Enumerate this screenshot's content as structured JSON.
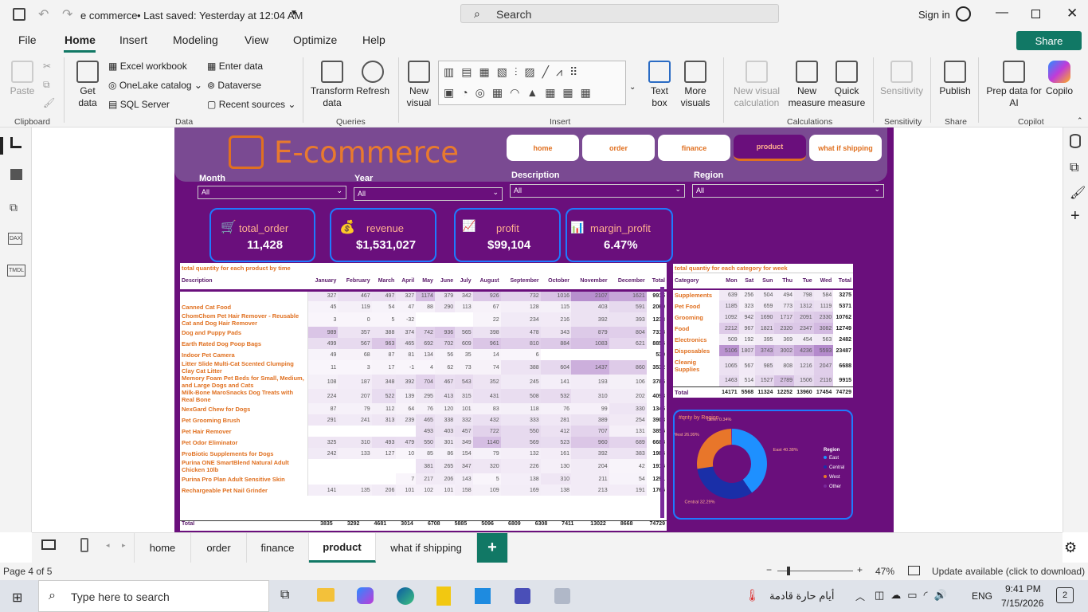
{
  "titlebar": {
    "title": "e commerce",
    "saved": "• Last saved: Yesterday at 12:04 AM",
    "search": "Search",
    "signin": "Sign in"
  },
  "menu": [
    "File",
    "Home",
    "Insert",
    "Modeling",
    "View",
    "Optimize",
    "Help"
  ],
  "share": "Share",
  "ribbon": {
    "paste": "Paste",
    "clipboard": "Clipboard",
    "get_data": "Get data",
    "excel": "Excel workbook",
    "onelake": "OneLake catalog",
    "sql": "SQL Server",
    "enter_data": "Enter data",
    "dataverse": "Dataverse",
    "recent": "Recent sources",
    "data": "Data",
    "transform": "Transform data",
    "refresh": "Refresh",
    "queries": "Queries",
    "new_visual": "New visual",
    "text_box": "Text box",
    "more_visuals": "More visuals",
    "insert": "Insert",
    "new_visual_calc": "New visual calculation",
    "new_measure": "New measure",
    "quick_measure": "Quick measure",
    "calculations": "Calculations",
    "sensitivity": "Sensitivity",
    "sensitivity_grp": "Sensitivity",
    "publish": "Publish",
    "share_grp": "Share",
    "prep": "Prep data for AI",
    "copilot": "Copilo",
    "copilot_grp": "Copilot"
  },
  "report": {
    "title": "E-commerce",
    "nav": [
      "home",
      "order",
      "finance",
      "product",
      "what if shipping"
    ],
    "filters": [
      {
        "label": "Month",
        "value": "All"
      },
      {
        "label": "Year",
        "value": "All"
      },
      {
        "label": "Description",
        "value": "All"
      },
      {
        "label": "Region",
        "value": "All"
      }
    ],
    "cards": [
      {
        "label": "total_order",
        "value": "11,428"
      },
      {
        "label": "revenue",
        "value": "$1,531,027"
      },
      {
        "label": "profit",
        "value": "$99,104"
      },
      {
        "label": "margin_profit",
        "value": "6.47%"
      }
    ],
    "table1": {
      "title": "total quantity for each product by time",
      "headers": [
        "Description",
        "January",
        "February",
        "March",
        "April",
        "May",
        "June",
        "July",
        "August",
        "September",
        "October",
        "November",
        "December",
        "Total"
      ],
      "rows": [
        [
          "",
          "327",
          "467",
          "497",
          "327",
          "1174",
          "379",
          "342",
          "926",
          "732",
          "1016",
          "2107",
          "1621",
          "9915"
        ],
        [
          "Canned Cat Food",
          "45",
          "119",
          "54",
          "47",
          "88",
          "290",
          "113",
          "67",
          "128",
          "115",
          "403",
          "591",
          "2060"
        ],
        [
          "ChomChom Pet Hair Remover - Reusable Cat and Dog Hair Remover",
          "3",
          "0",
          "5",
          "-32",
          "",
          "",
          "",
          "22",
          "234",
          "216",
          "392",
          "393",
          "1233"
        ],
        [
          "Dog and Puppy Pads",
          "989",
          "357",
          "388",
          "374",
          "742",
          "936",
          "565",
          "398",
          "478",
          "343",
          "879",
          "804",
          "7313"
        ],
        [
          "Earth Rated Dog Poop Bags",
          "499",
          "567",
          "963",
          "465",
          "692",
          "702",
          "609",
          "961",
          "810",
          "884",
          "1083",
          "621",
          "8856"
        ],
        [
          "Indoor Pet Camera",
          "49",
          "68",
          "87",
          "81",
          "134",
          "56",
          "35",
          "14",
          "6",
          "",
          "",
          "",
          "530"
        ],
        [
          "Litter Slide Multi-Cat Scented Clumping Clay Cat Litter",
          "11",
          "3",
          "17",
          "-1",
          "4",
          "62",
          "73",
          "74",
          "388",
          "604",
          "1437",
          "860",
          "3532"
        ],
        [
          "Memory Foam Pet Beds for Small, Medium, and Large Dogs and Cats",
          "108",
          "187",
          "348",
          "392",
          "704",
          "467",
          "543",
          "352",
          "245",
          "141",
          "193",
          "106",
          "3786"
        ],
        [
          "Milk-Bone MaroSnacks Dog Treats with Real Bone",
          "224",
          "207",
          "522",
          "139",
          "295",
          "413",
          "315",
          "431",
          "508",
          "532",
          "310",
          "202",
          "4098"
        ],
        [
          "NexGard Chew for Dogs",
          "87",
          "79",
          "112",
          "64",
          "76",
          "120",
          "101",
          "83",
          "118",
          "76",
          "99",
          "330",
          "1345"
        ],
        [
          "Pet Grooming Brush",
          "291",
          "241",
          "313",
          "239",
          "465",
          "338",
          "332",
          "432",
          "333",
          "281",
          "389",
          "254",
          "3908"
        ],
        [
          "Pet Hair Remover",
          "",
          "",
          "",
          "",
          "493",
          "403",
          "457",
          "722",
          "550",
          "412",
          "707",
          "131",
          "3855"
        ],
        [
          "Pet Odor Eliminator",
          "325",
          "310",
          "493",
          "479",
          "550",
          "301",
          "349",
          "1140",
          "569",
          "523",
          "960",
          "689",
          "6688"
        ],
        [
          "ProBiotic Supplements for Dogs",
          "242",
          "133",
          "127",
          "10",
          "85",
          "86",
          "154",
          "79",
          "132",
          "161",
          "392",
          "383",
          "1984"
        ],
        [
          "Purina ONE SmartBlend Natural Adult Chicken 10lb",
          "",
          "",
          "",
          "",
          "381",
          "265",
          "347",
          "320",
          "226",
          "130",
          "204",
          "42",
          "1915"
        ],
        [
          "Purina Pro Plan Adult Sensitive Skin",
          "",
          "",
          "",
          "7",
          "217",
          "206",
          "143",
          "5",
          "138",
          "310",
          "211",
          "54",
          "1291"
        ],
        [
          "Rechargeable Pet Nail Grinder",
          "141",
          "135",
          "206",
          "101",
          "102",
          "101",
          "158",
          "109",
          "169",
          "138",
          "213",
          "191",
          "1766"
        ]
      ],
      "total": [
        "Total",
        "3835",
        "3292",
        "4681",
        "3014",
        "6708",
        "5885",
        "5096",
        "6809",
        "6308",
        "7411",
        "13022",
        "8668",
        "74729"
      ]
    },
    "table2": {
      "title": "total quantiy for each category for week",
      "headers": [
        "Category",
        "Mon",
        "Sat",
        "Sun",
        "Thu",
        "Tue",
        "Wed",
        "Total"
      ],
      "rows": [
        [
          "Supplements",
          "639",
          "256",
          "504",
          "494",
          "798",
          "584",
          "3275"
        ],
        [
          "Pet Food",
          "1185",
          "323",
          "659",
          "773",
          "1312",
          "1119",
          "5371"
        ],
        [
          "Grooming",
          "1092",
          "942",
          "1690",
          "1717",
          "2091",
          "2330",
          "10762"
        ],
        [
          "Food",
          "2212",
          "967",
          "1821",
          "2320",
          "2347",
          "3082",
          "12749"
        ],
        [
          "Electronics",
          "509",
          "192",
          "395",
          "369",
          "454",
          "563",
          "2482"
        ],
        [
          "Disposables",
          "5106",
          "1807",
          "3743",
          "3002",
          "4236",
          "5593",
          "23487"
        ],
        [
          "Cleanig Supplies",
          "1065",
          "567",
          "985",
          "808",
          "1216",
          "2047",
          "6688"
        ],
        [
          "",
          "1463",
          "514",
          "1527",
          "2789",
          "1506",
          "2116",
          "9915"
        ]
      ],
      "total": [
        "Total",
        "14171",
        "5568",
        "11324",
        "12252",
        "13960",
        "17454",
        "74729"
      ]
    },
    "chart_data": {
      "type": "pie",
      "title": "#qnty by Region",
      "legend_title": "Region",
      "legend_position": "right",
      "categories": [
        "East",
        "Central",
        "West",
        "Other"
      ],
      "values": [
        40.38,
        32.29,
        26.99,
        0.34
      ],
      "labels": [
        "East 40.38%",
        "Central 32.29%",
        "West 26.99%",
        "Other 0.34%"
      ],
      "colors": [
        "#1e90ff",
        "#1a2fa8",
        "#e8762a",
        "#7a2a9a"
      ]
    }
  },
  "pages": [
    "home",
    "order",
    "finance",
    "product",
    "what if shipping"
  ],
  "status": {
    "page": "Page 4 of 5",
    "zoom": "47%",
    "update": "Update available (click to download)"
  },
  "taskbar": {
    "search": "Type here to search",
    "weather": "أيام حارة قادمة",
    "lang": "ENG",
    "time": "9:41 PM",
    "date": "7/15/2026",
    "notif": "2"
  }
}
